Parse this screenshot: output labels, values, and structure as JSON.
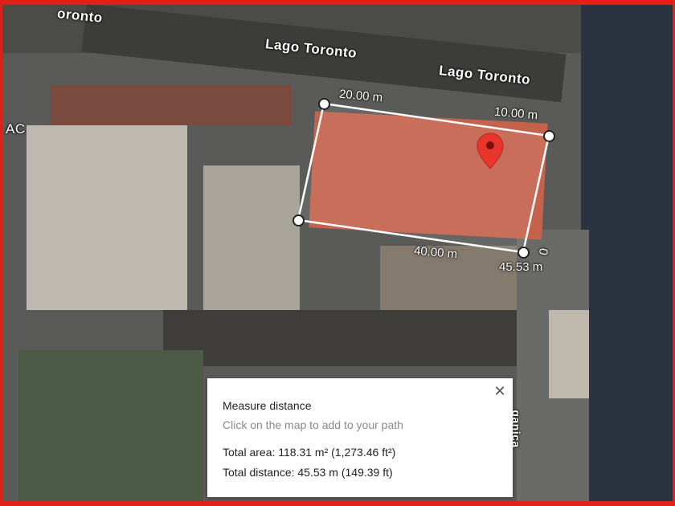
{
  "map": {
    "road_labels": [
      "Lago Toronto",
      "Lago Toronto",
      "oronto",
      "AC",
      "ganica"
    ],
    "measurement_labels": [
      "20.00 m",
      "10.00 m",
      "40.00 m",
      "0",
      "45.53 m"
    ],
    "marker_icon": "map-pin-icon",
    "colors": {
      "frame": "#e0201b",
      "marker": "#e8362d",
      "path": "#ffffff"
    }
  },
  "panel": {
    "title": "Measure distance",
    "hint": "Click on the map to add to your path",
    "total_area": "Total area: 118.31 m² (1,273.46 ft²)",
    "total_distance": "Total distance: 45.53 m (149.39 ft)",
    "close_icon": "close-icon"
  }
}
